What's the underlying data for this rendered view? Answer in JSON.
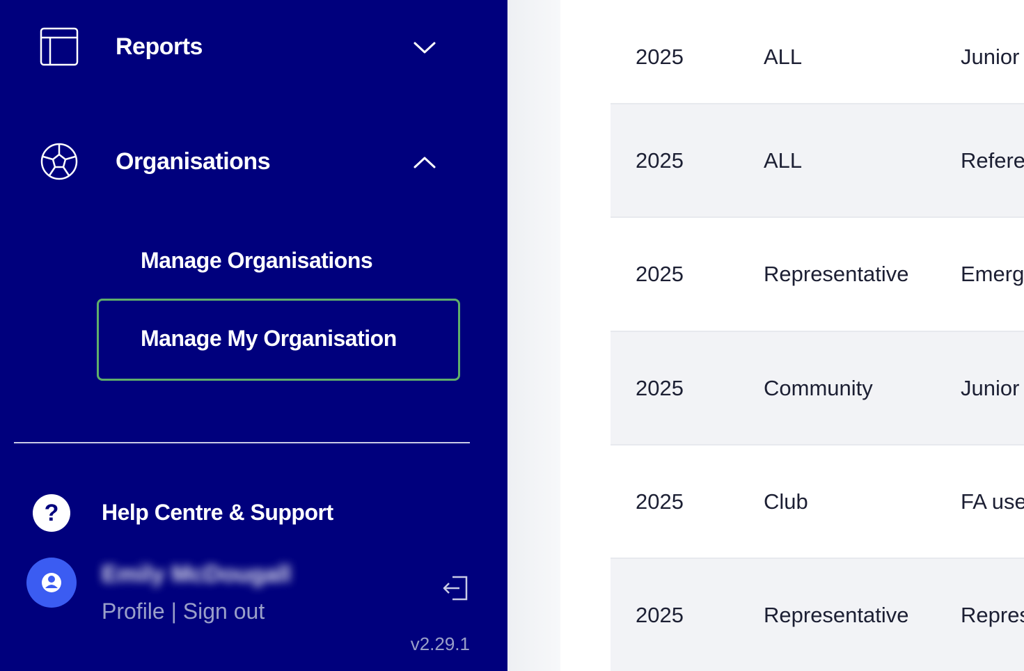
{
  "sidebar": {
    "reports": {
      "label": "Reports",
      "icon": "table-layout-icon",
      "chevron": "chevron-down-icon"
    },
    "organisations": {
      "label": "Organisations",
      "icon": "soccer-ball-icon",
      "chevron": "chevron-up-icon",
      "children": [
        {
          "label": "Manage Organisations"
        },
        {
          "label": "Manage My Organisation",
          "highlighted": true
        }
      ]
    },
    "help": {
      "label": "Help Centre & Support",
      "icon": "question-circle-icon"
    },
    "user": {
      "name": "Emily McDougall",
      "profile_label": "Profile",
      "separator": "|",
      "signout_label": "Sign out",
      "avatar_icon": "user-avatar-icon",
      "logout_icon": "logout-icon"
    },
    "version": "v2.29.1"
  },
  "colors": {
    "sidebar_bg": "#00007d",
    "highlight_border": "#5fae6a",
    "avatar_bg": "#3b5cf2",
    "row_alt_bg": "#f2f3f6"
  },
  "table": {
    "rows": [
      {
        "year": "2025",
        "type": "ALL",
        "name": "Junior S"
      },
      {
        "year": "2025",
        "type": "ALL",
        "name": "Referee"
      },
      {
        "year": "2025",
        "type": "Representative",
        "name": "Emergi"
      },
      {
        "year": "2025",
        "type": "Community",
        "name": "Junior ("
      },
      {
        "year": "2025",
        "type": "Club",
        "name": "FA use"
      },
      {
        "year": "2025",
        "type": "Representative",
        "name": "Repres"
      }
    ]
  }
}
